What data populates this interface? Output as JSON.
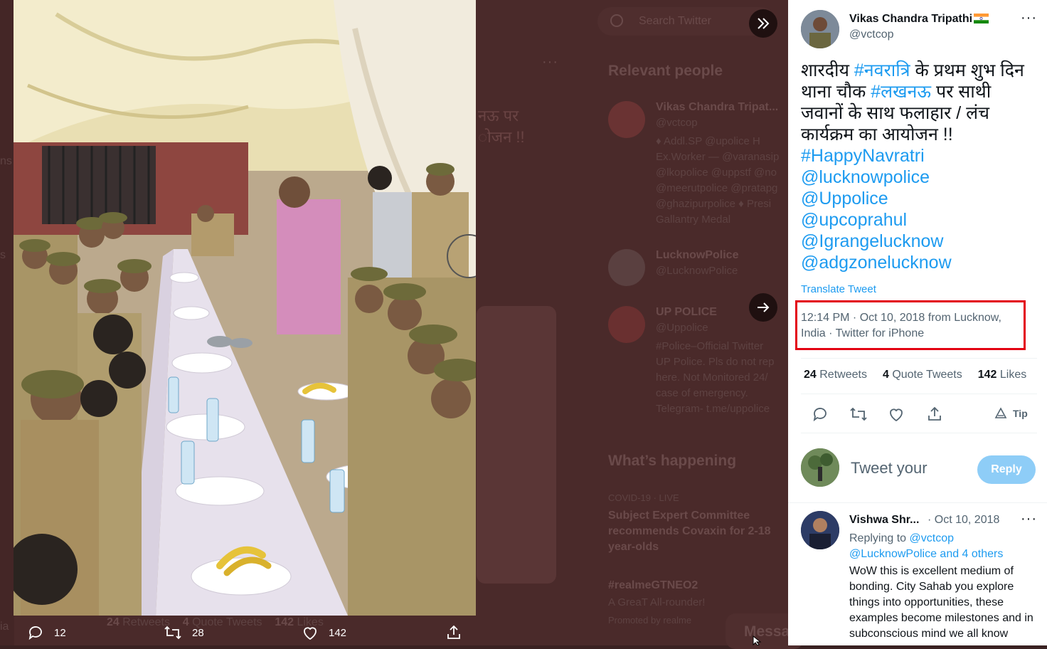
{
  "background": {
    "search_placeholder": "Search Twitter",
    "bg_hindi_fragment": "नऊ पर\nोजन !!",
    "relevant_people_title": "Relevant people",
    "people": [
      {
        "name": "Vikas Chandra Tripat...",
        "handle": "@vctcop",
        "bio": "♦ Addl.SP @upolice H\nEx.Worker — @varanasip\n@lkopolice @uppstf @no\n@meerutpolice @pratapg\n@ghazipurpolice ♦ Presi\nGallantry Medal"
      },
      {
        "name": "LucknowPolice",
        "handle": "@LucknowPolice",
        "bio": ""
      },
      {
        "name": "UP POLICE",
        "handle": "@Uppolice",
        "bio": "#Police–Official Twitter\nUP Police. Pls do not rep\nhere. Not Monitored 24/\ncase of emergency.\nTelegram- t.me/uppolice"
      }
    ],
    "whats_happening_title": "What’s happening",
    "trend1_category": "COVID-19 · LIVE",
    "trend1_headline": "Subject Expert Committee recommends Covaxin for 2-18 year-olds",
    "trend2_tag": "#realmeGTNEO2",
    "trend2_sub": "A GreaT All-rounder!",
    "trend2_promo": "Promoted by realme",
    "bg_stats_retweets": "24",
    "bg_stats_retweets_label": "Retweets",
    "bg_stats_quotes": "4",
    "bg_stats_quotes_label": "Quote Tweets",
    "bg_stats_likes": "142",
    "bg_stats_likes_label": "Likes",
    "message_label": "Messa",
    "left_fragment_1": "ns",
    "left_fragment_2": "s",
    "left_fragment_3": "ia"
  },
  "media_actions": {
    "replies": "12",
    "retweets": "28",
    "likes": "142"
  },
  "tweet": {
    "author_name": "Vikas Chandra Tripathi",
    "author_handle": "@vctcop",
    "text_part1": "शारदीय ",
    "hashtag1": "#नवरात्रि",
    "text_part2": " के प्रथम शुभ दिन थाना चौक ",
    "hashtag2": "#लखनऊ",
    "text_part3": " पर साथी जवानों के साथ फलाहार / लंच कार्यक्रम का आयोजन !!",
    "hashtag3": "#HappyNavratri",
    "mention1": "@lucknowpolice",
    "mention2": "@Uppolice",
    "mention3": "@upcoprahul",
    "mention4": "@Igrangelucknow",
    "mention5": "@adgzonelucknow",
    "translate_label": "Translate Tweet",
    "meta": "12:14 PM · Oct 10, 2018 from Lucknow, India · Twitter for iPhone",
    "retweets": "24",
    "retweets_label": "Retweets",
    "quote_tweets": "4",
    "quote_tweets_label": "Quote Tweets",
    "likes": "142",
    "likes_label": "Likes",
    "tip_label": "Tip",
    "reply_placeholder": "Tweet your",
    "reply_button": "Reply"
  },
  "reply": {
    "name": "Vishwa Shr...",
    "date": "· Oct 10, 2018",
    "replying_prefix": "Replying to ",
    "replying_to": "@vctcop",
    "replying_others": "@LucknowPolice and 4 others",
    "text": "WoW this is excellent medium of bonding. City Sahab you explore things into opportunities, these examples become milestones and in subconscious mind we all know"
  },
  "colors": {
    "accent": "#1d9bf0",
    "highlight_border": "#e30012",
    "overlay_bg": "#4a2a2a"
  }
}
